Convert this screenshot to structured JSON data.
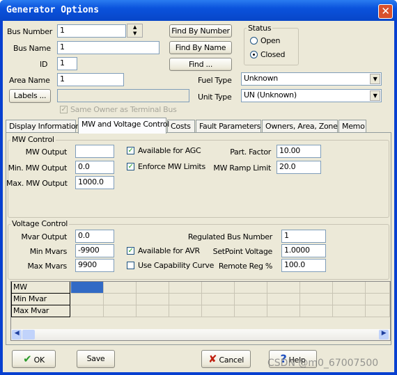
{
  "window": {
    "title": "Generator Options"
  },
  "header": {
    "bus_number": {
      "label": "Bus Number",
      "value": "1"
    },
    "bus_name": {
      "label": "Bus Name",
      "value": "1"
    },
    "id": {
      "label": "ID",
      "value": "1"
    },
    "area_name": {
      "label": "Area Name",
      "value": "1"
    },
    "labels_button": "Labels ...",
    "labels_value": "",
    "same_owner": {
      "label": "Same Owner as Terminal Bus",
      "checked": true,
      "disabled": true
    },
    "find_by_number": "Find By Number",
    "find_by_name": "Find By Name",
    "find": "Find ...",
    "status": {
      "title": "Status",
      "options": [
        "Open",
        "Closed"
      ],
      "selected": "Closed"
    },
    "fuel_type": {
      "label": "Fuel Type",
      "value": "Unknown"
    },
    "unit_type": {
      "label": "Unit Type",
      "value": "UN (Unknown)"
    }
  },
  "tabs": [
    {
      "label": "Display Information"
    },
    {
      "label": "MW and Voltage Control",
      "active": true
    },
    {
      "label": "Costs"
    },
    {
      "label": "Fault Parameters"
    },
    {
      "label": "Owners, Area, Zone"
    },
    {
      "label": "Memo"
    }
  ],
  "mw_control": {
    "title": "MW Control",
    "mw_output": {
      "label": "MW Output",
      "value": ""
    },
    "min_mw_output": {
      "label": "Min. MW Output",
      "value": "0.0"
    },
    "max_mw_output": {
      "label": "Max. MW Output",
      "value": "1000.0"
    },
    "available_agc": {
      "label": "Available for AGC",
      "checked": true
    },
    "enforce_mw_limits": {
      "label": "Enforce MW Limits",
      "checked": true
    },
    "part_factor": {
      "label": "Part. Factor",
      "value": "10.00"
    },
    "mw_ramp_limit": {
      "label": "MW Ramp Limit",
      "value": "20.0"
    }
  },
  "voltage_control": {
    "title": "Voltage Control",
    "mvar_output": {
      "label": "Mvar Output",
      "value": "0.0"
    },
    "min_mvars": {
      "label": "Min Mvars",
      "value": "-9900"
    },
    "max_mvars": {
      "label": "Max Mvars",
      "value": "9900"
    },
    "available_avr": {
      "label": "Available for AVR",
      "checked": true
    },
    "use_capability_curve": {
      "label": "Use Capability Curve",
      "checked": false
    },
    "regulated_bus_number": {
      "label": "Regulated Bus Number",
      "value": "1"
    },
    "setpoint_voltage": {
      "label": "SetPoint Voltage",
      "value": "1.0000"
    },
    "remote_reg": {
      "label": "Remote Reg %",
      "value": "100.0"
    }
  },
  "capability_grid": {
    "rows": [
      "MW",
      "Min Mvar",
      "Max Mvar"
    ]
  },
  "footer": {
    "ok": "OK",
    "save": "Save",
    "cancel": "Cancel",
    "help": "Help"
  },
  "watermark": "CSDN @m0_67007500",
  "colors": {
    "title_bar": "#0a52dc",
    "selected_cell": "#316ac5",
    "dialog_bg": "#ece9d8"
  }
}
